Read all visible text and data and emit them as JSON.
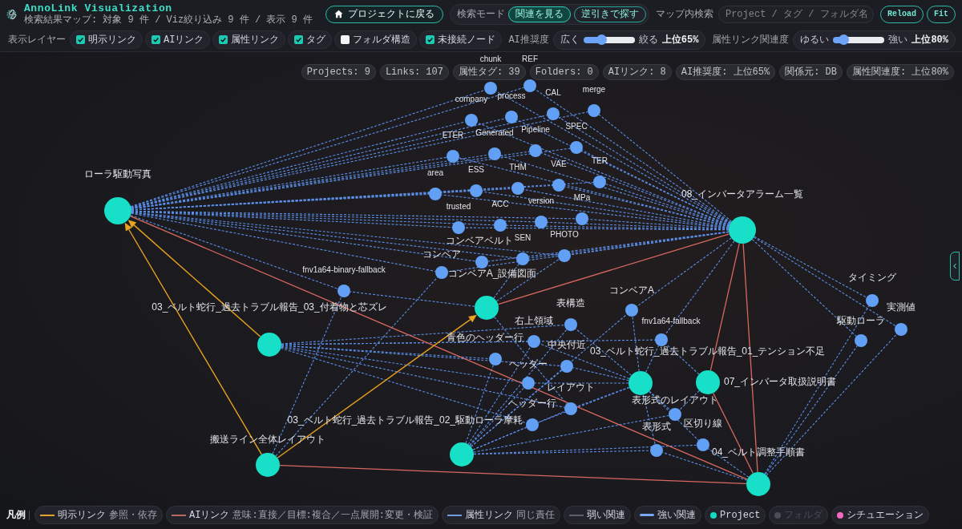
{
  "header": {
    "title": "AnnoLink Visualization",
    "subtitle": "検索結果マップ: 対象 9 件 / Viz絞り込み 9 件 / 表示 9 件",
    "back_button": "プロジェクトに戻る",
    "search_mode": {
      "label": "検索モード",
      "options": [
        {
          "label": "関連を見る",
          "selected": true
        },
        {
          "label": "逆引きで探す",
          "selected": false
        }
      ]
    },
    "map_search": {
      "label": "マップ内検索",
      "placeholder": "Project / タグ / フォルダ名"
    },
    "buttons": [
      "Reload",
      "Fit"
    ]
  },
  "layers": {
    "label": "表示レイヤー",
    "items": [
      {
        "label": "明示リンク",
        "checked": true
      },
      {
        "label": "AIリンク",
        "checked": true
      },
      {
        "label": "属性リンク",
        "checked": true
      },
      {
        "label": "タグ",
        "checked": true
      },
      {
        "label": "フォルダ構造",
        "checked": false
      },
      {
        "label": "未接続ノード",
        "checked": true
      }
    ]
  },
  "sliders": [
    {
      "label": "AI推奨度",
      "min_label": "広く",
      "max_label": "絞る",
      "level": 0.35,
      "reading": "上位65%"
    },
    {
      "label": "属性リンク関連度",
      "min_label": "ゆるい",
      "max_label": "強い",
      "level": 0.2,
      "reading": "上位80%"
    }
  ],
  "stats": [
    "Projects: 9",
    "Links: 107",
    "属性タグ: 39",
    "Folders: 0",
    "AIリンク: 8",
    "AI推奨度: 上位65%",
    "関係元: DB",
    "属性関連度: 上位80%"
  ],
  "graph": {
    "nodes": [
      {
        "label": "chunk",
        "kind": "tag"
      },
      {
        "label": "REF",
        "kind": "tag"
      },
      {
        "label": "company",
        "kind": "tag"
      },
      {
        "label": "process",
        "kind": "tag"
      },
      {
        "label": "CAL",
        "kind": "tag"
      },
      {
        "label": "merge",
        "kind": "tag"
      },
      {
        "label": "ETER",
        "kind": "tag"
      },
      {
        "label": "Generated",
        "kind": "tag"
      },
      {
        "label": "Pipeline",
        "kind": "tag"
      },
      {
        "label": "SPEC",
        "kind": "tag"
      },
      {
        "label": "ローラ駆動写真",
        "kind": "project"
      },
      {
        "label": "area",
        "kind": "tag"
      },
      {
        "label": "ESS",
        "kind": "tag"
      },
      {
        "label": "THM",
        "kind": "tag"
      },
      {
        "label": "VAE",
        "kind": "tag"
      },
      {
        "label": "TER",
        "kind": "tag"
      },
      {
        "label": "trusted",
        "kind": "tag"
      },
      {
        "label": "ACC",
        "kind": "tag"
      },
      {
        "label": "version",
        "kind": "tag"
      },
      {
        "label": "MPa",
        "kind": "tag"
      },
      {
        "label": "08_インバータアラーム一覧",
        "kind": "project"
      },
      {
        "label": "コンベアベルト",
        "kind": "tag"
      },
      {
        "label": "SEN",
        "kind": "tag"
      },
      {
        "label": "PHOTO",
        "kind": "tag"
      },
      {
        "label": "コンベア",
        "kind": "tag"
      },
      {
        "label": "fnv1a64-binary-fallback",
        "kind": "tag"
      },
      {
        "label": "コンベアA_設備図面",
        "kind": "project"
      },
      {
        "label": "タイミング",
        "kind": "tag"
      },
      {
        "label": "コンベアA",
        "kind": "tag"
      },
      {
        "label": "03_ベルト蛇行_過去トラブル報告_03_付着物と芯ズレ",
        "kind": "project"
      },
      {
        "label": "表構造",
        "kind": "tag"
      },
      {
        "label": "実測値",
        "kind": "tag"
      },
      {
        "label": "右上領域",
        "kind": "tag"
      },
      {
        "label": "fnv1a64-fallback",
        "kind": "tag"
      },
      {
        "label": "駆動ローラ",
        "kind": "tag"
      },
      {
        "label": "青色のヘッダー行",
        "kind": "tag"
      },
      {
        "label": "中央付近",
        "kind": "tag"
      },
      {
        "label": "03_ベルト蛇行_過去トラブル報告_01_テンション不足",
        "kind": "project"
      },
      {
        "label": "ヘッダー",
        "kind": "tag"
      },
      {
        "label": "レイアウト",
        "kind": "tag"
      },
      {
        "label": "07_インバータ取扱説明書",
        "kind": "project"
      },
      {
        "label": "ヘッダー行",
        "kind": "tag"
      },
      {
        "label": "表形式のレイアウト",
        "kind": "tag"
      },
      {
        "label": "03_ベルト蛇行_過去トラブル報告_02_駆動ローラ摩耗",
        "kind": "project"
      },
      {
        "label": "表形式",
        "kind": "tag"
      },
      {
        "label": "区切り線",
        "kind": "tag"
      },
      {
        "label": "搬送ライン全体レイアウト",
        "kind": "project"
      },
      {
        "label": "04_ベルト調整手順書",
        "kind": "project"
      }
    ]
  },
  "legend": {
    "title": "凡例",
    "items": [
      {
        "kind": "line",
        "label": "明示リンク",
        "note": "参照・依存",
        "color": "#e3a32b",
        "disabled": false
      },
      {
        "kind": "line",
        "label": "AIリンク",
        "note": "意味:直接／目標:複合／一点展開:変更・検証",
        "color": "#b86d63",
        "disabled": false
      },
      {
        "kind": "line",
        "label": "属性リンク",
        "note": "同じ責任",
        "color": "#6f9fe0",
        "disabled": false
      },
      {
        "kind": "line",
        "label": "弱い関連",
        "color": "#5b5e68",
        "disabled": false
      },
      {
        "kind": "thick-line",
        "label": "強い関連",
        "color": "#7aa8f5",
        "disabled": false
      },
      {
        "kind": "dot",
        "label": "Project",
        "color": "#14d9c4",
        "disabled": false
      },
      {
        "kind": "dot",
        "label": "フォルダ",
        "color": "#4a4d55",
        "disabled": true
      },
      {
        "kind": "dot",
        "label": "シチュエーション",
        "color": "#f06bc0",
        "disabled": false
      }
    ]
  }
}
